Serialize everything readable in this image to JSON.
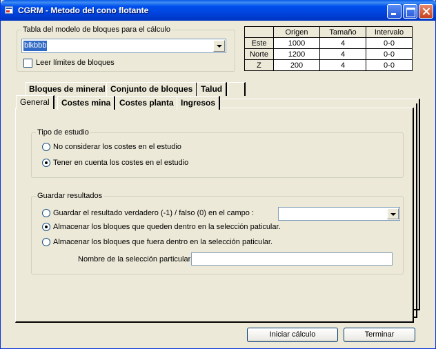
{
  "window": {
    "title": "CGRM - Metodo del cono flotante"
  },
  "model_group": {
    "legend": "Tabla del modelo de bloques para el cálculo",
    "selected_table": "blkbbb",
    "read_limits_label": "Leer límites de bloques",
    "read_limits_checked": false
  },
  "grid": {
    "headers": [
      "",
      "Origen",
      "Tamaño",
      "Intervalo"
    ],
    "rows": [
      {
        "axis": "Este",
        "origen": "1000",
        "tamano": "4",
        "intervalo": "0-0"
      },
      {
        "axis": "Norte",
        "origen": "1200",
        "tamano": "4",
        "intervalo": "0-0"
      },
      {
        "axis": "Z",
        "origen": "200",
        "tamano": "4",
        "intervalo": "0-0"
      }
    ]
  },
  "tabs_back": [
    "Bloques de mineral",
    "Conjunto de bloques",
    "Talud",
    ""
  ],
  "tabs_front": [
    "General",
    "Costes mina",
    "Costes planta",
    "Ingresos"
  ],
  "active_tab": "General",
  "study_group": {
    "legend": "Tipo de estudio",
    "options": [
      {
        "label": "No considerar los costes en el estudio",
        "checked": false
      },
      {
        "label": "Tener en cuenta los costes en el estudio",
        "checked": true
      }
    ]
  },
  "save_group": {
    "legend": "Guardar resultados",
    "options": [
      {
        "label": "Guardar el resultado verdadero (-1) / falso (0) en el campo :",
        "checked": false
      },
      {
        "label": "Almacenar los bloques que queden dentro en la selección paticular.",
        "checked": true
      },
      {
        "label": "Almacenar los bloques que fuera dentro en la selección paticular.",
        "checked": false
      }
    ],
    "field_combo_value": "",
    "selection_name_label": "Nombre de la selección particular :",
    "selection_name_value": ""
  },
  "buttons": {
    "start": "Iniciar cálculo",
    "finish": "Terminar"
  }
}
